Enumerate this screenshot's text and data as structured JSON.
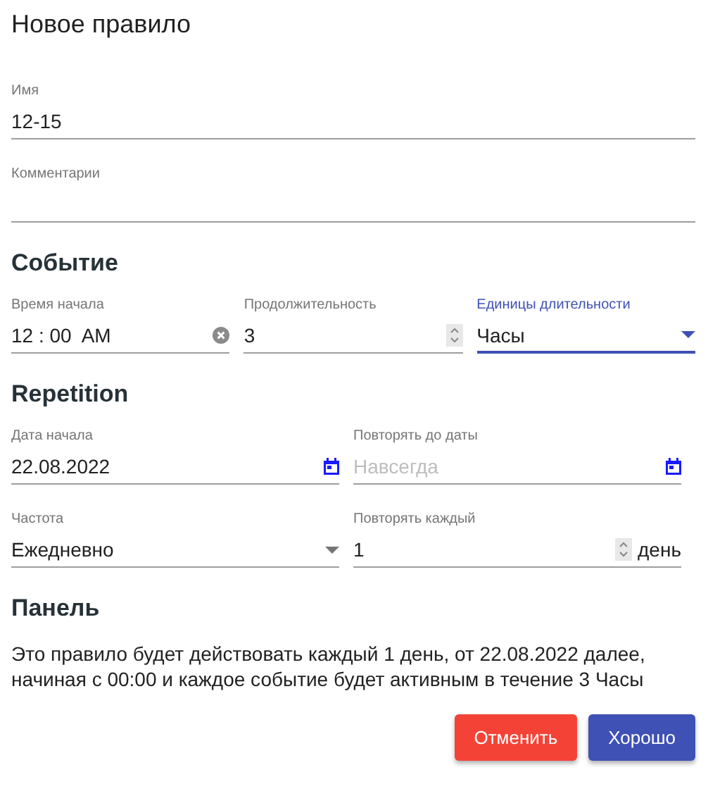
{
  "title": "Новое правило",
  "groups": [
    {
      "rows": [
        [
          {
            "kind": "text",
            "label": "Имя",
            "value": "12-15",
            "focused": false
          }
        ],
        [
          {
            "kind": "text",
            "label": "Комментарии",
            "focused": false
          }
        ]
      ]
    },
    {
      "heading": "Событие",
      "rows": [
        [
          {
            "kind": "time",
            "label": "Время начала",
            "value": "12 : 00  AM",
            "focused": false
          },
          {
            "kind": "number",
            "label": "Продолжительность",
            "value": "3",
            "focused": false
          },
          {
            "kind": "select",
            "label": "Единицы длительности",
            "value": "Часы",
            "focused": true
          }
        ]
      ]
    },
    {
      "heading": "Repetition",
      "rows": [
        [
          {
            "kind": "date",
            "label": "Дата начала",
            "value": "22.08.2022",
            "focused": false
          },
          {
            "kind": "date",
            "label": "Повторять до даты",
            "placeholder": "Навсегда",
            "focused": false
          }
        ],
        [
          {
            "kind": "select",
            "label": "Частота",
            "value": "Ежедневно",
            "focused": false
          },
          {
            "kind": "number",
            "label": "Повторять каждый",
            "value": "1",
            "suffix": "день",
            "focused": false
          }
        ]
      ]
    }
  ],
  "panel": {
    "heading": "Панель",
    "text": "Это правило будет действовать каждый 1 день, от 22.08.2022 далее, начиная с 00:00 и каждое событие будет активным в течение 3 Часы"
  },
  "buttons": [
    {
      "label": "Отменить",
      "kind": "cancel"
    },
    {
      "label": "Хорошо",
      "kind": "ok"
    }
  ]
}
